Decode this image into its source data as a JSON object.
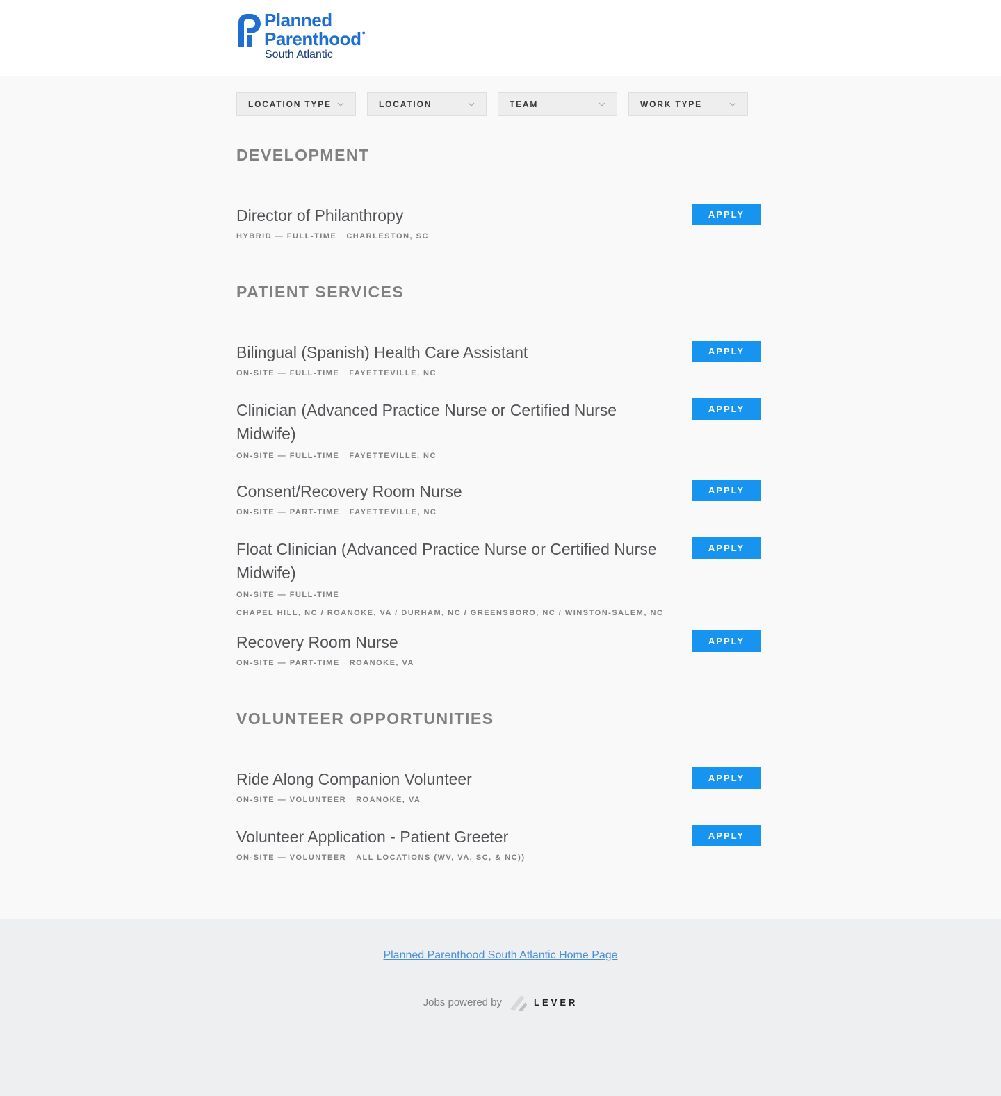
{
  "brand": {
    "line1": "Planned",
    "line2": "Parenthood",
    "line3": "South Atlantic",
    "color_primary": "#1f6fd1",
    "color_secondary": "#1d3a78"
  },
  "filters": [
    {
      "label": "LOCATION TYPE"
    },
    {
      "label": "LOCATION"
    },
    {
      "label": "TEAM"
    },
    {
      "label": "WORK TYPE"
    }
  ],
  "sections": [
    {
      "title": "DEVELOPMENT",
      "postings": [
        {
          "title": "Director of Philanthropy",
          "commitment": "HYBRID — FULL-TIME",
          "location": "CHARLESTON, SC",
          "apply": "APPLY"
        }
      ]
    },
    {
      "title": "PATIENT SERVICES",
      "postings": [
        {
          "title": "Bilingual (Spanish) Health Care Assistant",
          "commitment": "ON-SITE — FULL-TIME",
          "location": "FAYETTEVILLE, NC",
          "apply": "APPLY"
        },
        {
          "title": "Clinician (Advanced Practice Nurse or Certified Nurse Midwife)",
          "commitment": "ON-SITE — FULL-TIME",
          "location": "FAYETTEVILLE, NC",
          "apply": "APPLY"
        },
        {
          "title": "Consent/Recovery Room Nurse",
          "commitment": "ON-SITE — PART-TIME",
          "location": "FAYETTEVILLE, NC",
          "apply": "APPLY"
        },
        {
          "title": "Float Clinician (Advanced Practice Nurse or Certified Nurse Midwife)",
          "commitment": "ON-SITE — FULL-TIME",
          "location": "CHAPEL HILL, NC / ROANOKE, VA / DURHAM, NC / GREENSBORO, NC / WINSTON-SALEM, NC",
          "apply": "APPLY"
        },
        {
          "title": "Recovery Room Nurse",
          "commitment": "ON-SITE — PART-TIME",
          "location": "ROANOKE, VA",
          "apply": "APPLY"
        }
      ]
    },
    {
      "title": "VOLUNTEER OPPORTUNITIES",
      "postings": [
        {
          "title": "Ride Along Companion Volunteer",
          "commitment": "ON-SITE — VOLUNTEER",
          "location": "ROANOKE, VA",
          "apply": "APPLY"
        },
        {
          "title": "Volunteer Application - Patient Greeter",
          "commitment": "ON-SITE — VOLUNTEER",
          "location": "ALL LOCATIONS (WV, VA, SC, & NC))",
          "apply": "APPLY"
        }
      ]
    }
  ],
  "footer": {
    "home_link": "Planned Parenthood South Atlantic Home Page",
    "powered_by": "Jobs powered by",
    "lever": "LEVER"
  },
  "colors": {
    "apply_button": "#1694f0",
    "link": "#4a90d9"
  }
}
